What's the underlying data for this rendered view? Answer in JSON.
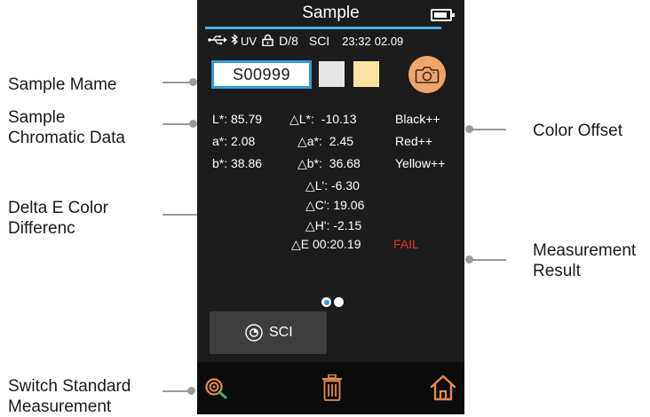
{
  "callouts": {
    "sample_name": "Sample Mame",
    "sample_chromatic": "Sample\nChromatic Data",
    "delta_e": "Delta E Color\nDifferenc",
    "switch_standard": "Switch Standard\nMeasurement",
    "color_offset": "Color Offset",
    "measurement_result": "Measurement\nResult"
  },
  "device": {
    "title": "Sample",
    "status": {
      "uv": "UV",
      "geometry": "D/8",
      "mode": "SCI",
      "time": "23:32",
      "date": "02.09"
    },
    "sample_id": "S00999",
    "swatch_colors": {
      "sample": "#e6e6e6",
      "standard": "#fbe2a3"
    },
    "lab": [
      {
        "label": "L*:",
        "value": "85.79"
      },
      {
        "label": "a*:",
        "value": "2.08"
      },
      {
        "label": "b*:",
        "value": "38.86"
      }
    ],
    "delta_lab": [
      {
        "label": "△L*:",
        "value": "-10.13",
        "desc": "Black++"
      },
      {
        "label": "△a*:",
        "value": "2.45",
        "desc": "Red++"
      },
      {
        "label": "△b*:",
        "value": "36.68",
        "desc": "Yellow++"
      }
    ],
    "delta_lch": [
      {
        "label": "△L':",
        "value": "-6.30"
      },
      {
        "label": "△C':",
        "value": "19.06"
      },
      {
        "label": "△H':",
        "value": "-2.15"
      }
    ],
    "delta_e": {
      "label": "△E 00:",
      "value": "20.19",
      "result": "FAIL"
    },
    "sci_button": "SCI",
    "page": {
      "current": 1,
      "total": 2
    },
    "icons": {
      "usb": "usb-icon",
      "bluetooth": "bluetooth-icon",
      "lock": "lock-icon",
      "battery": "battery-icon",
      "camera": "camera-icon",
      "sci": "aperture-icon",
      "switch": "switch-standard-icon",
      "delete": "trash-icon",
      "home": "home-icon"
    },
    "colors": {
      "accent": "#4ab3e6",
      "screen": "#1c1c1c",
      "fail": "#e0312d",
      "icon_orange": "#e8884a",
      "sample_border": "#2f9ce0"
    }
  }
}
